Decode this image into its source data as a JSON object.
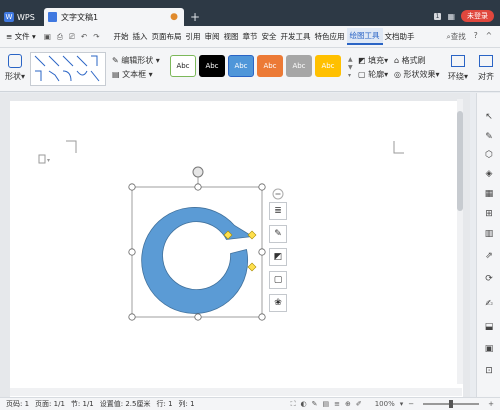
{
  "titlebar": {
    "app_tab": "WPS",
    "doc_tab": "文字文稿1",
    "badge": "1",
    "login_label": "未登录"
  },
  "menubar": {
    "file_label": "文件",
    "items": [
      "开始",
      "插入",
      "页面布局",
      "引用",
      "审阅",
      "视图",
      "章节",
      "安全",
      "开发工具",
      "特色应用",
      "绘图工具",
      "文档助手"
    ],
    "active_index": 10,
    "search_label": "查找"
  },
  "ribbon": {
    "shape_label": "形状",
    "edit_shape_label": "编辑形状",
    "textbox_label": "文本框",
    "style_label": "Abc",
    "styles": [
      {
        "bg": "#ffffff",
        "fg": "#222222",
        "border": "#7cb85a"
      },
      {
        "bg": "#000000",
        "fg": "#ffffff",
        "border": "#000000"
      },
      {
        "bg": "#4f96d9",
        "fg": "#ffffff",
        "border": "#2a64c5"
      },
      {
        "bg": "#ec7a36",
        "fg": "#ffffff",
        "border": "#ec7a36"
      },
      {
        "bg": "#a6a6a6",
        "fg": "#ffffff",
        "border": "#a6a6a6"
      },
      {
        "bg": "#ffc000",
        "fg": "#ffffff",
        "border": "#ffc000"
      }
    ],
    "fill_label": "填充",
    "outline_label": "轮廓",
    "format_brush_label": "格式刷",
    "shape_effect_label": "形状效果",
    "wrap_label": "环绕",
    "align_label": "对齐"
  },
  "shape": {
    "fill": "#5b9bd5",
    "stroke": "#41719c"
  },
  "statusbar": {
    "page_count": "页码: 1",
    "page": "页面: 1/1",
    "section": "节: 1/1",
    "setting": "设置值: 2.5厘米",
    "row": "行: 1",
    "col": "列: 1",
    "zoom": "100%"
  }
}
